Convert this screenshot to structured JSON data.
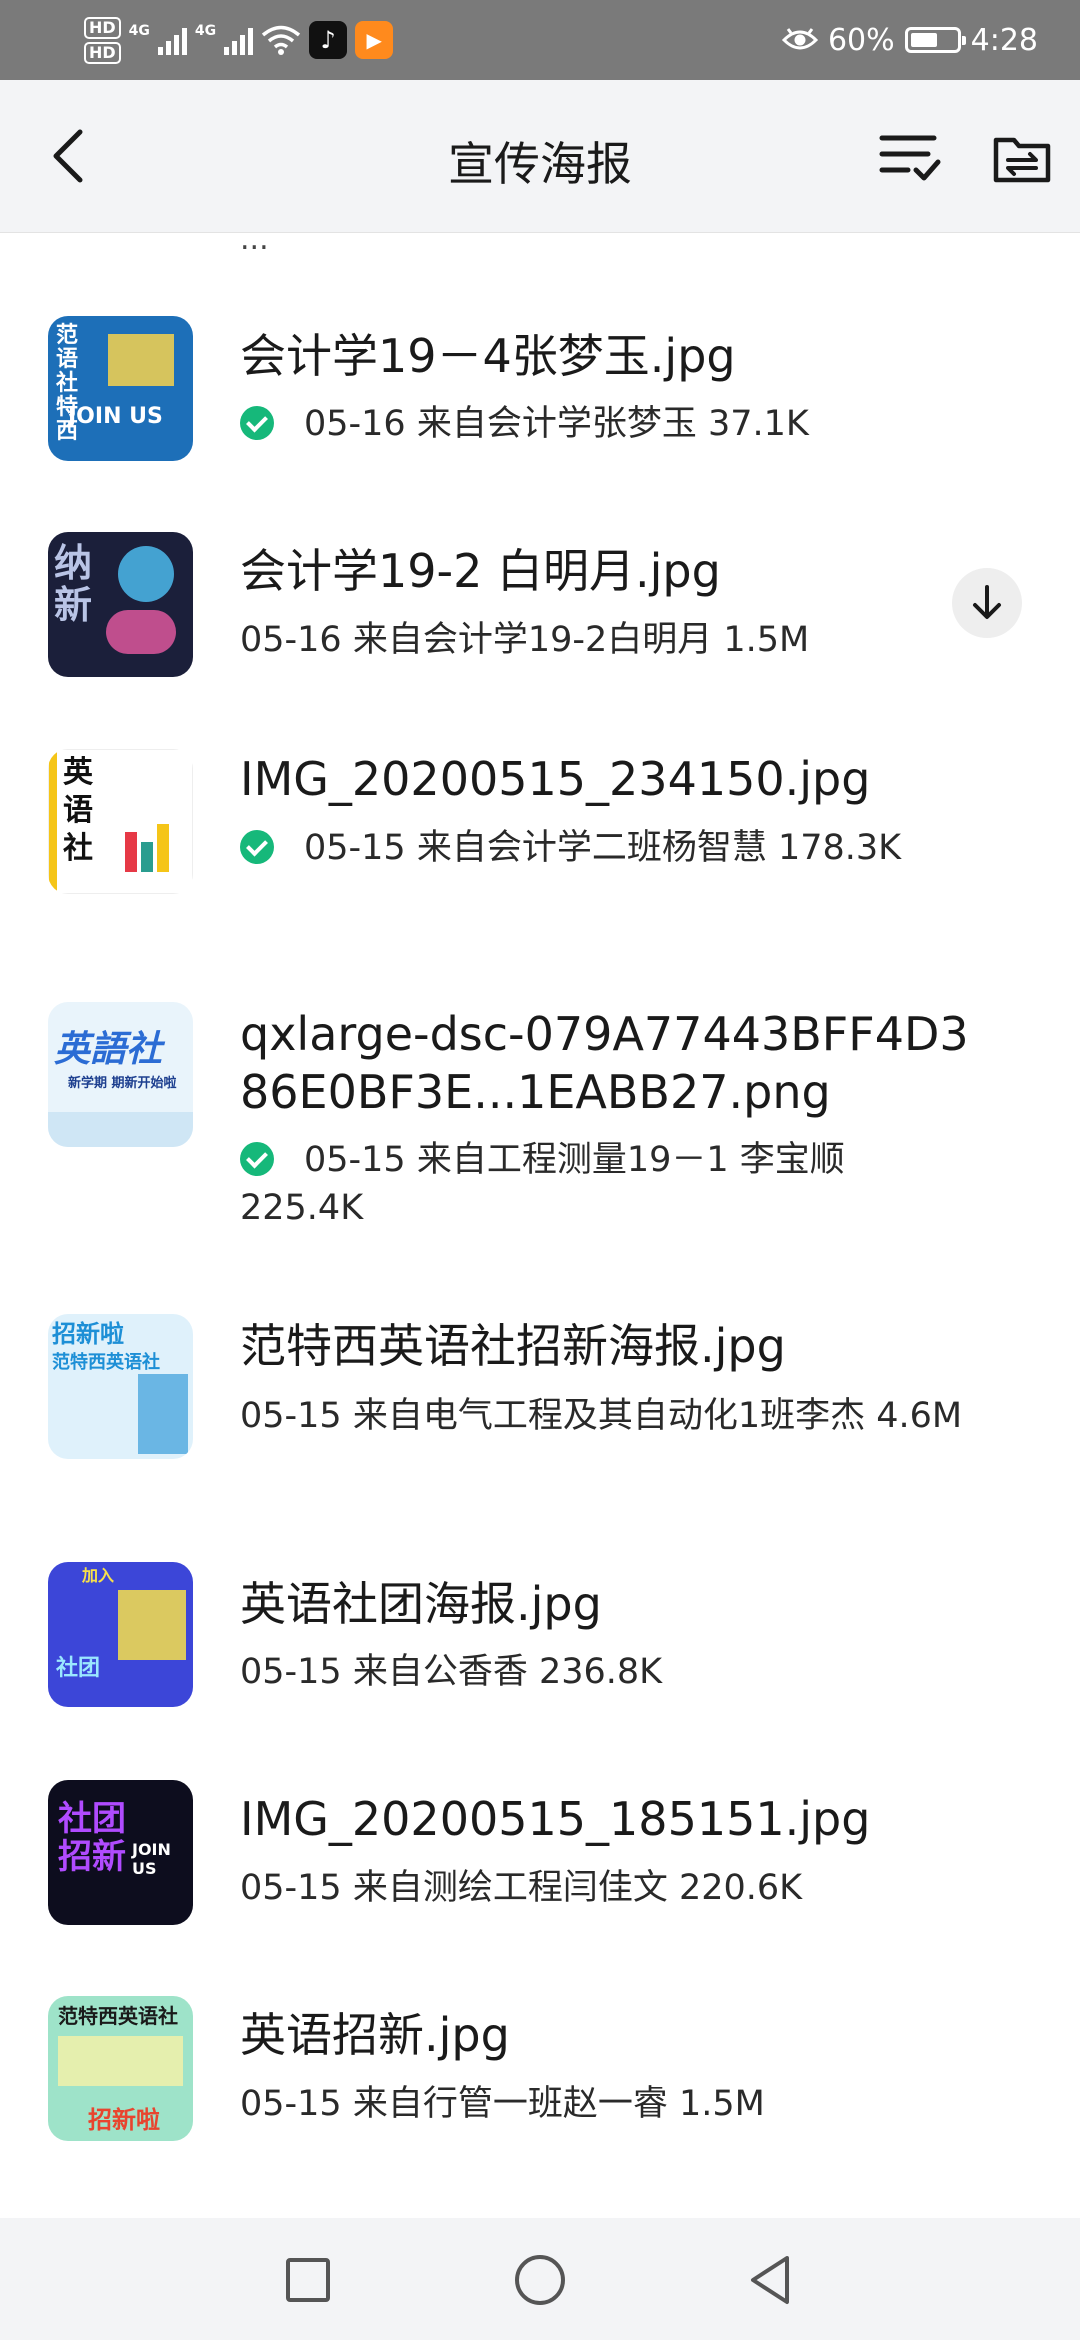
{
  "status_bar": {
    "hd1": "HD",
    "hd2": "HD",
    "net1": "4G",
    "net2": "4G",
    "battery_percent_label": "60%",
    "battery_level": 0.6,
    "time": "4:28",
    "icons": [
      "hd-icon",
      "signal-icon",
      "wifi-icon",
      "tiktok-app-icon",
      "video-app-icon",
      "eye-comfort-icon",
      "battery-icon"
    ]
  },
  "header": {
    "title": "宣传海报",
    "back_icon": "back-arrow-icon",
    "sort_icon": "sort-list-icon",
    "folder_icon": "folder-icon"
  },
  "clipped_previous_text": "...",
  "files": [
    {
      "name": "会计学19－4张梦玉.jpg",
      "meta": "05-16  来自会计学张梦玉  37.1K",
      "downloaded": true,
      "thumb": {
        "bg": "#1d6fb8",
        "accent": "#f7d44c",
        "line1": "范语社特西",
        "line2": "JOIN US"
      }
    },
    {
      "name": "会计学19-2 白明月.jpg",
      "meta": "05-16  来自会计学19-2白明月  1.5M",
      "downloaded": false,
      "thumb": {
        "bg": "#1b1f3a",
        "accent": "#4fc3f7",
        "line1": "纳新",
        "line2": ""
      }
    },
    {
      "name": "IMG_20200515_234150.jpg",
      "meta": "05-15  来自会计学二班杨智慧  178.3K",
      "downloaded": true,
      "thumb": {
        "bg": "#ffffff",
        "accent": "#f5c518",
        "line1": "英语社",
        "line2": ""
      }
    },
    {
      "name": "qxlarge-dsc-079A77443BFF4D386E0BF3E...1EABB27.png",
      "meta": "05-15  来自工程测量19－1 李宝顺  225.4K",
      "downloaded": true,
      "thumb": {
        "bg": "#e9f4fb",
        "accent": "#2b6cd4",
        "line1": "英語社",
        "line2": "新学期 期新开始啦"
      }
    },
    {
      "name": "范特西英语社招新海报.jpg",
      "meta": "05-15  来自电气工程及其自动化1班李杰  4.6M",
      "downloaded": false,
      "thumb": {
        "bg": "#dff1fb",
        "accent": "#1d8fd6",
        "line1": "招新啦",
        "line2": "范特西英语社"
      }
    },
    {
      "name": "英语社团海报.jpg",
      "meta": "05-15  来自公香香  236.8K",
      "downloaded": false,
      "thumb": {
        "bg": "#3c46d8",
        "accent": "#f7e04b",
        "line1": "加入",
        "line2": "社团"
      }
    },
    {
      "name": "IMG_20200515_185151.jpg",
      "meta": "05-15  来自测绘工程闫佳文  220.6K",
      "downloaded": false,
      "thumb": {
        "bg": "#0d0d1e",
        "accent": "#b04bff",
        "line1": "社团招新",
        "line2": "JOIN US"
      }
    },
    {
      "name": "英语招新.jpg",
      "meta": "05-15  来自行管一班赵一睿  1.5M",
      "downloaded": false,
      "thumb": {
        "bg": "#9ee3c9",
        "accent": "#e8452f",
        "line1": "范特西英语社",
        "line2": "招新啦"
      }
    }
  ],
  "nav": {
    "recents_icon": "square-recents-icon",
    "home_icon": "circle-home-icon",
    "back_icon": "triangle-back-icon"
  },
  "colors": {
    "status_bar": "#7a7a7a",
    "app_bar": "#f3f4f6",
    "check_green": "#16b87a",
    "text_primary": "#1a1a1a"
  }
}
